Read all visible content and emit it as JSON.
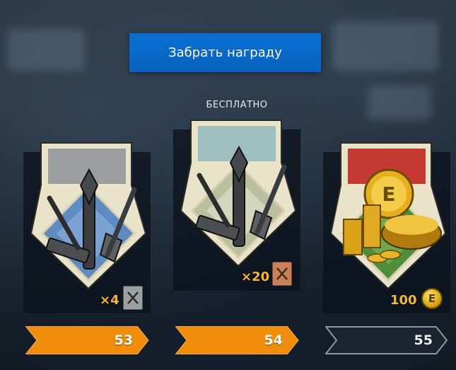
{
  "claim_button": {
    "label": "Забрать награду"
  },
  "free_label": "БЕСПЛАТНО",
  "rewards": [
    {
      "count": "×4",
      "badge_icon": "crossed-tools-icon",
      "badge_color": "#9aa0a4"
    },
    {
      "count": "×20",
      "badge_icon": "crossed-tools-icon",
      "badge_color": "#c9805b"
    },
    {
      "count": "100",
      "badge_icon": "e-coin-icon",
      "badge_text": "E"
    }
  ],
  "levels": [
    {
      "number": "53",
      "state": "completed"
    },
    {
      "number": "54",
      "state": "completed"
    },
    {
      "number": "55",
      "state": "locked"
    }
  ],
  "colors": {
    "accent_blue": "#0868c7",
    "level_orange": "#f08d0a",
    "count_gold": "#f5b63a"
  }
}
